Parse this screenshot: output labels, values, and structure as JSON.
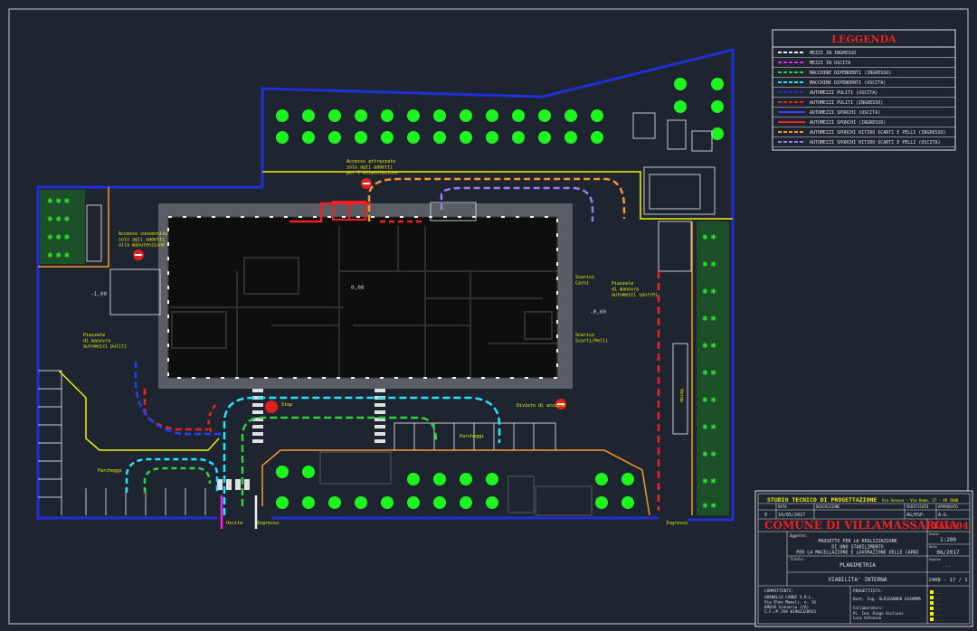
{
  "colors": {
    "background": "#1e2531",
    "frame": "#c8c8c8",
    "boundary": "#1f2fd6",
    "building": "#101010",
    "tree": "#1ef51e",
    "yellow": "#f0f000",
    "orange": "#f59a2a",
    "red": "#f02020",
    "cyan": "#20e8ff",
    "green": "#30d040",
    "violet": "#9a7af0",
    "magenta": "#f020f0",
    "white": "#f0f0f0"
  },
  "legend": {
    "title": "LEGGENDA",
    "items": [
      {
        "label": "MEZZI IN INGRESSO",
        "color": "#f0f0f0",
        "style": "dashed"
      },
      {
        "label": "MEZZI IN USCITA",
        "color": "#f020f0",
        "style": "dashed"
      },
      {
        "label": "MACCHINE DIPENDENTI (INGRESSO)",
        "color": "#30d040",
        "style": "dashed"
      },
      {
        "label": "MACCHINE DIPENDENTI (USCITA)",
        "color": "#20e8ff",
        "style": "dashed"
      },
      {
        "label": "AUTOMEZZI PULITI (USCITA)",
        "color": "#1f2fd6",
        "style": "dashed"
      },
      {
        "label": "AUTOMEZZI PULITI (INGRESSO)",
        "color": "#f02020",
        "style": "dashed"
      },
      {
        "label": "AUTOMEZZI SPORCHI (USCITA)",
        "color": "#4040ff",
        "style": "solid"
      },
      {
        "label": "AUTOMEZZI SPORCHI (INGRESSO)",
        "color": "#f02020",
        "style": "solid"
      },
      {
        "label": "AUTOMEZZI SPORCHI RITIRO SCARTI E PELLI (INGRESSO)",
        "color": "#f59a2a",
        "style": "dashed"
      },
      {
        "label": "AUTOMEZZI SPORCHI RITIRO SCARTI E PELLI (USCITA)",
        "color": "#9a7af0",
        "style": "dashed"
      }
    ]
  },
  "plan_labels": {
    "access_top": "Accesso attrezzato\nsolo agli addetti\nper l'alimentazione",
    "access_left": "Accesso consentito\nsolo agli addetti\nalla manutenzione",
    "piazzale_left": "Piazzale\ndi manovra\nautomezzi puliti",
    "piazzale_right": "Piazzale\ndi manovra\nautomezzi sporchi",
    "scarico_top": "Scarico\nCarni",
    "scarico_right": "Scarico\nScarti/Pelli",
    "stop": "Stop",
    "divieto": "Divieto di accesso",
    "parcheggi_left": "Parcheggi",
    "parcheggi_mid": "Parcheggi",
    "ingresso": "Ingresso",
    "uscita": "Uscita",
    "ingresso_right": "Ingresso",
    "quota_left": "-1,00",
    "quota_right": "-0,00",
    "quota_mid": "0,00",
    "verde_label": "Verde"
  },
  "title_block": {
    "studio": "STUDIO TECNICO DI PROGETTAZIONE",
    "studio_sub": "Via Genova - Via Roma, 27 - 09 5000",
    "header_cols": [
      "DATA",
      "DESCRIZIONE",
      "VERIFICATO",
      "APPROVATO"
    ],
    "revision": [
      "0",
      "10/05/2017",
      "",
      "AG/ESP.",
      "A.G."
    ],
    "comune": "COMUNE DI VILLAMASSARGIA",
    "tav_label": "TAV. 04",
    "oggetto_label": "Oggetto:",
    "oggetto": "PROGETTO PER LA REALIZZAZIONE\nDI UNO STABILIMENTO\nPER LA MACELLAZIONE E LAVORAZIONE DELLE CARNI",
    "scala_label": "Scala",
    "scala": "1:200",
    "data_label": "Data",
    "data": "06/2017",
    "titolo_label": "Titolo:",
    "titolo": "PLANIMETRIA",
    "descrizione": "VIABILITA' INTERNA",
    "fg_label": "Foglio",
    "fg": "--",
    "num": "2408 - 17 / 1",
    "committente_label": "COMMITTENTE:",
    "committente": "GRANELLA CARNI S.R.L.\nVia Elmo Mameli, n. 16\n09010 Sinnaria (CA)\nC.F./P.IVA 01901320923",
    "progettista_label": "PROGETTISTA:",
    "progettista": "Dott. Ing. ALESSANDRO ASSUMMA",
    "collaboratori_label": "Collaboratori:",
    "collaboratori": "Pi. Ind. Diego Giuliani\nLuca Antonino"
  }
}
